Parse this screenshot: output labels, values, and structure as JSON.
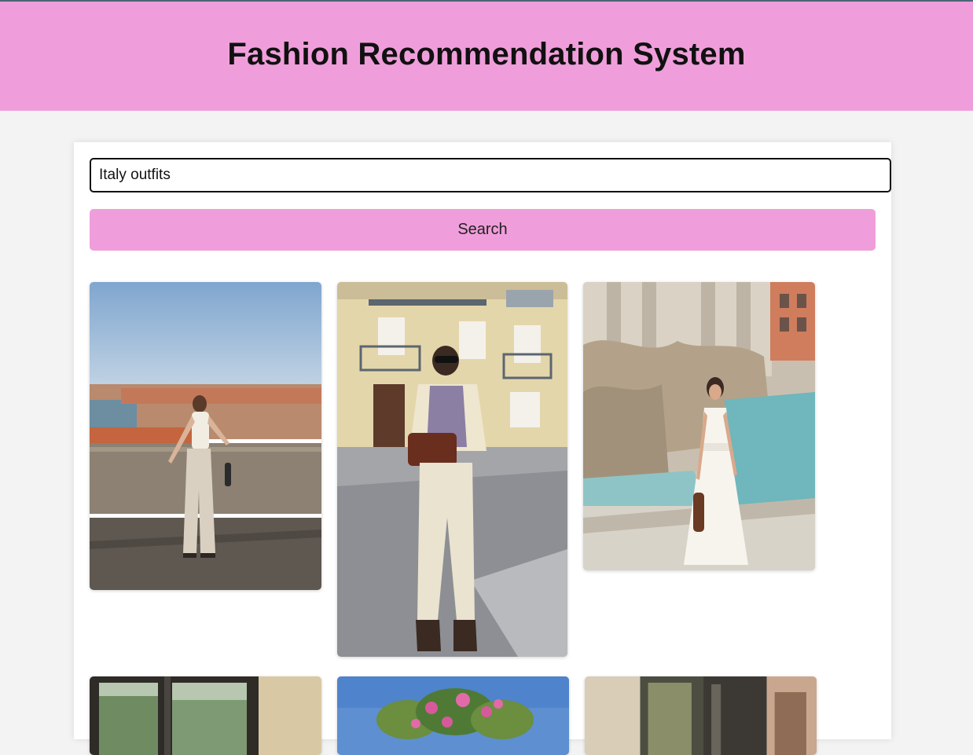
{
  "header": {
    "title": "Fashion Recommendation System"
  },
  "search": {
    "value": "Italy outfits",
    "button_label": "Search"
  },
  "results": [
    {
      "name": "outfit-photo-porto-white-vest"
    },
    {
      "name": "outfit-photo-striped-shirt-brown-bag"
    },
    {
      "name": "outfit-photo-trevi-fountain-white-dress"
    },
    {
      "name": "outfit-photo-window-interior"
    },
    {
      "name": "outfit-photo-bougainvillea"
    },
    {
      "name": "outfit-photo-stone-alley"
    }
  ],
  "colors": {
    "header_bg": "#f09edb",
    "button_bg": "#f09edb",
    "page_bg": "#f3f3f3",
    "card_bg": "#ffffff"
  }
}
